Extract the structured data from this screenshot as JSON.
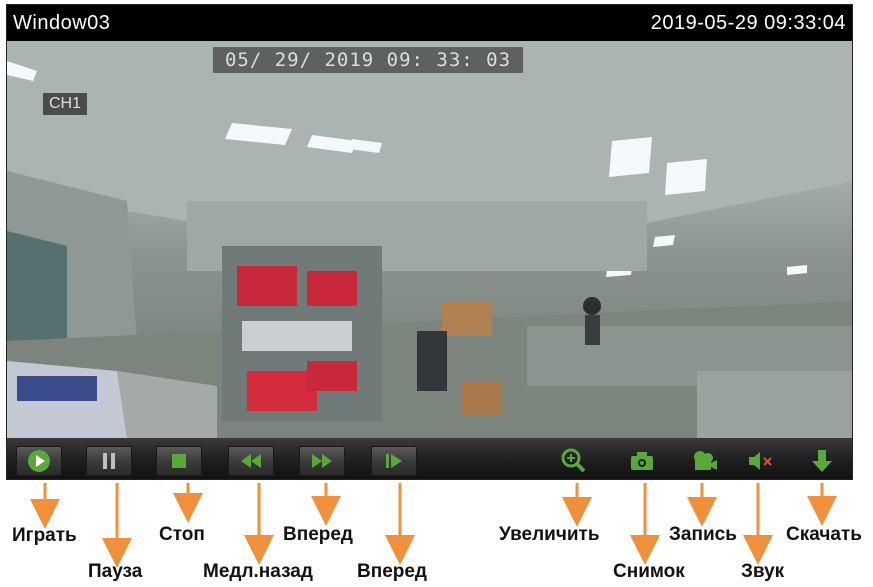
{
  "window": {
    "title": "Window03",
    "timestamp": "2019-05-29 09:33:04"
  },
  "video": {
    "osd_timestamp": "05/ 29/ 2019  09: 33: 03",
    "channel": "CH1"
  },
  "controls": {
    "buttons": [
      {
        "id": "play",
        "icon": "play-icon"
      },
      {
        "id": "pause",
        "icon": "pause-icon"
      },
      {
        "id": "stop",
        "icon": "stop-icon"
      },
      {
        "id": "slow_back",
        "icon": "rewind-icon"
      },
      {
        "id": "fast_forward",
        "icon": "fast-forward-icon"
      },
      {
        "id": "step_forward",
        "icon": "step-forward-icon"
      },
      {
        "id": "zoom",
        "icon": "zoom-in-icon"
      },
      {
        "id": "snapshot",
        "icon": "camera-icon"
      },
      {
        "id": "record",
        "icon": "video-camera-icon"
      },
      {
        "id": "sound",
        "icon": "speaker-muted-icon"
      },
      {
        "id": "download",
        "icon": "download-icon"
      }
    ],
    "accent_color": "#5aa83a",
    "annotation_arrow_color": "#f0903a"
  },
  "labels": {
    "play": "Играть",
    "pause": "Пауза",
    "stop": "Стоп",
    "slow_back": "Медл.назад",
    "fast_forward": "Вперед",
    "step_forward": "Вперед",
    "zoom": "Увеличить",
    "snapshot": "Снимок",
    "record": "Запись",
    "sound": "Звук",
    "download": "Скачать"
  }
}
